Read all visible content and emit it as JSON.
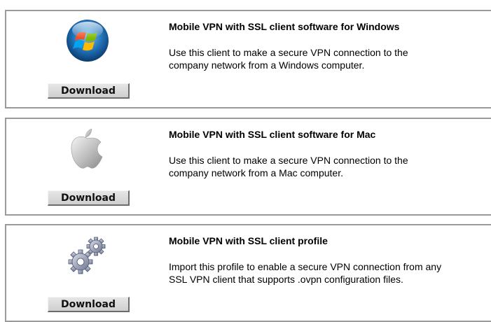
{
  "downloads": [
    {
      "title": "Mobile VPN with SSL client software for Windows",
      "desc_line1": "Use this client to make a secure VPN connection to the",
      "desc_line2": "company network from a Windows computer.",
      "button": "Download",
      "icon": "windows-logo-icon"
    },
    {
      "title": "Mobile VPN with SSL client software for Mac",
      "desc_line1": "Use this client to make a secure VPN connection to the",
      "desc_line2": "company network from a Mac computer.",
      "button": "Download",
      "icon": "apple-logo-icon"
    },
    {
      "title": "Mobile VPN with SSL client profile",
      "desc_line1": "Import this profile to enable a secure VPN connection from any",
      "desc_line2": "SSL VPN client that supports .ovpn configuration files.",
      "button": "Download",
      "icon": "gears-icon"
    }
  ],
  "colors": {
    "panel_border": "#9a9a9a",
    "button_face": "#dcdcdc"
  }
}
